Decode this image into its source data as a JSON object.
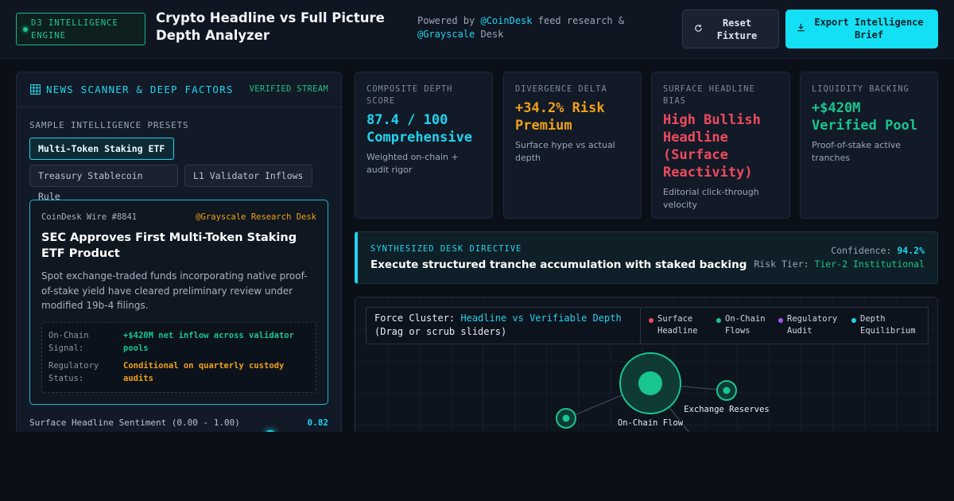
{
  "header": {
    "engine_badge": "D3 INTELLIGENCE ENGINE",
    "title": "Crypto Headline vs Full Picture Depth Analyzer",
    "powered_prefix": "Powered by ",
    "powered_source1": "@CoinDesk",
    "powered_middle": " feed research & ",
    "powered_source2": "@Grayscale",
    "powered_suffix": " Desk",
    "reset_label": "Reset Fixture",
    "export_label": "Export Intelligence Brief"
  },
  "scanner": {
    "title": "NEWS SCANNER & DEEP FACTORS",
    "status": "VERIFIED STREAM",
    "presets_label": "SAMPLE INTELLIGENCE PRESETS",
    "presets": [
      "Multi-Token Staking ETF",
      "Treasury Stablecoin Rule",
      "L1 Validator Inflows"
    ],
    "active_preset": "Multi-Token Staking ETF"
  },
  "news": {
    "wire": "CoinDesk Wire #8841",
    "desk": "@Grayscale Research Desk",
    "headline": "SEC Approves First Multi-Token Staking ETF Product",
    "summary": "Spot exchange-traded funds incorporating native proof-of-stake yield have cleared preliminary review under modified 19b-4 filings.",
    "onchain_label": "On-Chain Signal:",
    "onchain_value": "+$420M net inflow across validator pools",
    "regulatory_label": "Regulatory Status:",
    "regulatory_value": "Conditional on quarterly custody audits"
  },
  "sentiment": {
    "label": "Surface Headline Sentiment (0.00 - 1.00)",
    "value": "0.82",
    "level": 0.82
  },
  "metrics": [
    {
      "label": "COMPOSITE DEPTH SCORE",
      "value": "87.4 / 100 Comprehensive",
      "note": "Weighted on-chain + audit rigor",
      "color": "#22d3ee"
    },
    {
      "label": "DIVERGENCE DELTA",
      "value": "+34.2% Risk Premium",
      "note": "Surface hype vs actual depth",
      "color": "#f0a019"
    },
    {
      "label": "SURFACE HEADLINE BIAS",
      "value": "High Bullish Headline (Surface Reactivity)",
      "note": "Editorial click-through velocity",
      "color": "#f04a5e"
    },
    {
      "label": "LIQUIDITY BACKING",
      "value": "+$420M Verified Pool",
      "note": "Proof-of-stake active tranches",
      "color": "#19c58f"
    }
  ],
  "directive": {
    "label": "SYNTHESIZED DESK DIRECTIVE",
    "text": "Execute structured tranche accumulation with staked backing",
    "confidence_label": "Confidence: ",
    "confidence_value": "94.2%",
    "risk_label": "Risk Tier: ",
    "risk_value": "Tier-2 Institutional"
  },
  "graph": {
    "cluster_prefix": "Force Cluster: ",
    "cluster_highlight": "Headline vs Verifiable Depth",
    "cluster_hint": "(Drag or scrub sliders)",
    "legend": [
      {
        "label": "Surface Headline",
        "color": "#f04a5e"
      },
      {
        "label": "On-Chain Flows",
        "color": "#19c58f"
      },
      {
        "label": "Regulatory Audit",
        "color": "#a855f7"
      },
      {
        "label": "Depth Equilibrium",
        "color": "#22d3ee"
      }
    ],
    "nodes": [
      {
        "label": "On-Chain Flow"
      },
      {
        "label": "Exchange Reserves"
      },
      {
        "label": ""
      }
    ]
  },
  "icons": {
    "reset": "refresh-icon",
    "export": "download-icon",
    "scanner": "grid-icon"
  }
}
